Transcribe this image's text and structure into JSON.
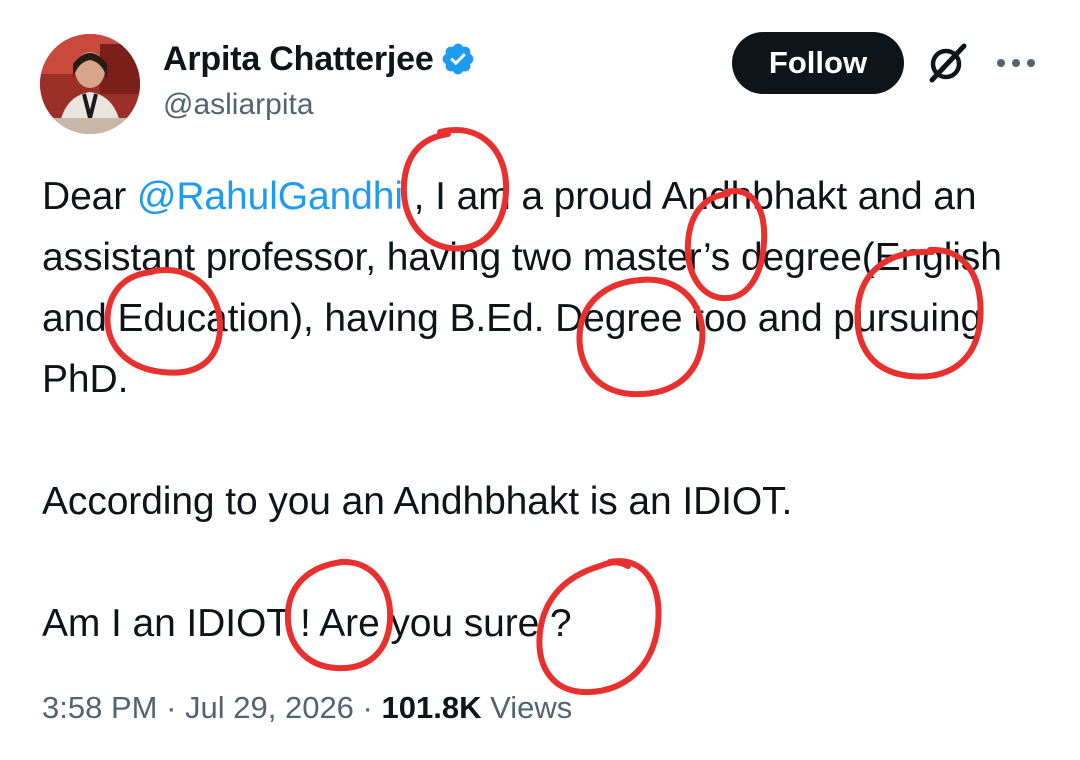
{
  "author": {
    "display_name": "Arpita Chatterjee",
    "handle": "@asliarpita",
    "verified": true,
    "avatar": "profile-photo"
  },
  "actions": {
    "follow_label": "Follow",
    "grok_icon": "grok-icon",
    "more_icon": "more-options-icon"
  },
  "tweet": {
    "line1_pre": "Dear ",
    "line1_mention": "@RahulGandhi",
    "line1_post": " , I am a proud Andhbhakt and an assistant professor, having two master’s degree(English and Education), having B.Ed. Degree too and pursuing PhD.",
    "paragraph2": "According to you an Andhbhakt is an IDIOT.",
    "paragraph3": "Am I an IDIOT ! Are you sure ?"
  },
  "meta": {
    "time": "3:58 PM",
    "sep1": " · ",
    "date": "Jul 29, 2026",
    "sep2": " · ",
    "views_count": "101.8K",
    "views_label": " Views"
  },
  "colors": {
    "mention": "#1d9bf0",
    "verified": "#1d9bf0",
    "annotation": "#e8302e",
    "follow_bg": "#0f1419"
  }
}
